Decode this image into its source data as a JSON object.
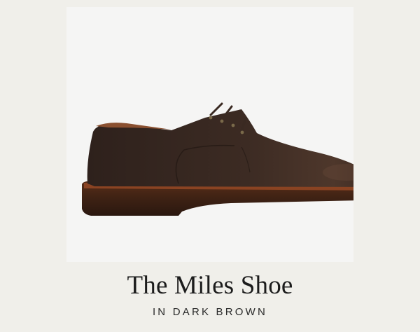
{
  "product": {
    "name": "The Miles Shoe",
    "color_line": "IN DARK BROWN",
    "image_icon": "derby-shoe-icon"
  },
  "colors": {
    "page_background": "#f0efea",
    "panel_background": "#f5f5f4",
    "leather": "#3a2a23",
    "welt": "#7a3a1f",
    "sole": "#3b2418",
    "text": "#1c1c1c"
  }
}
